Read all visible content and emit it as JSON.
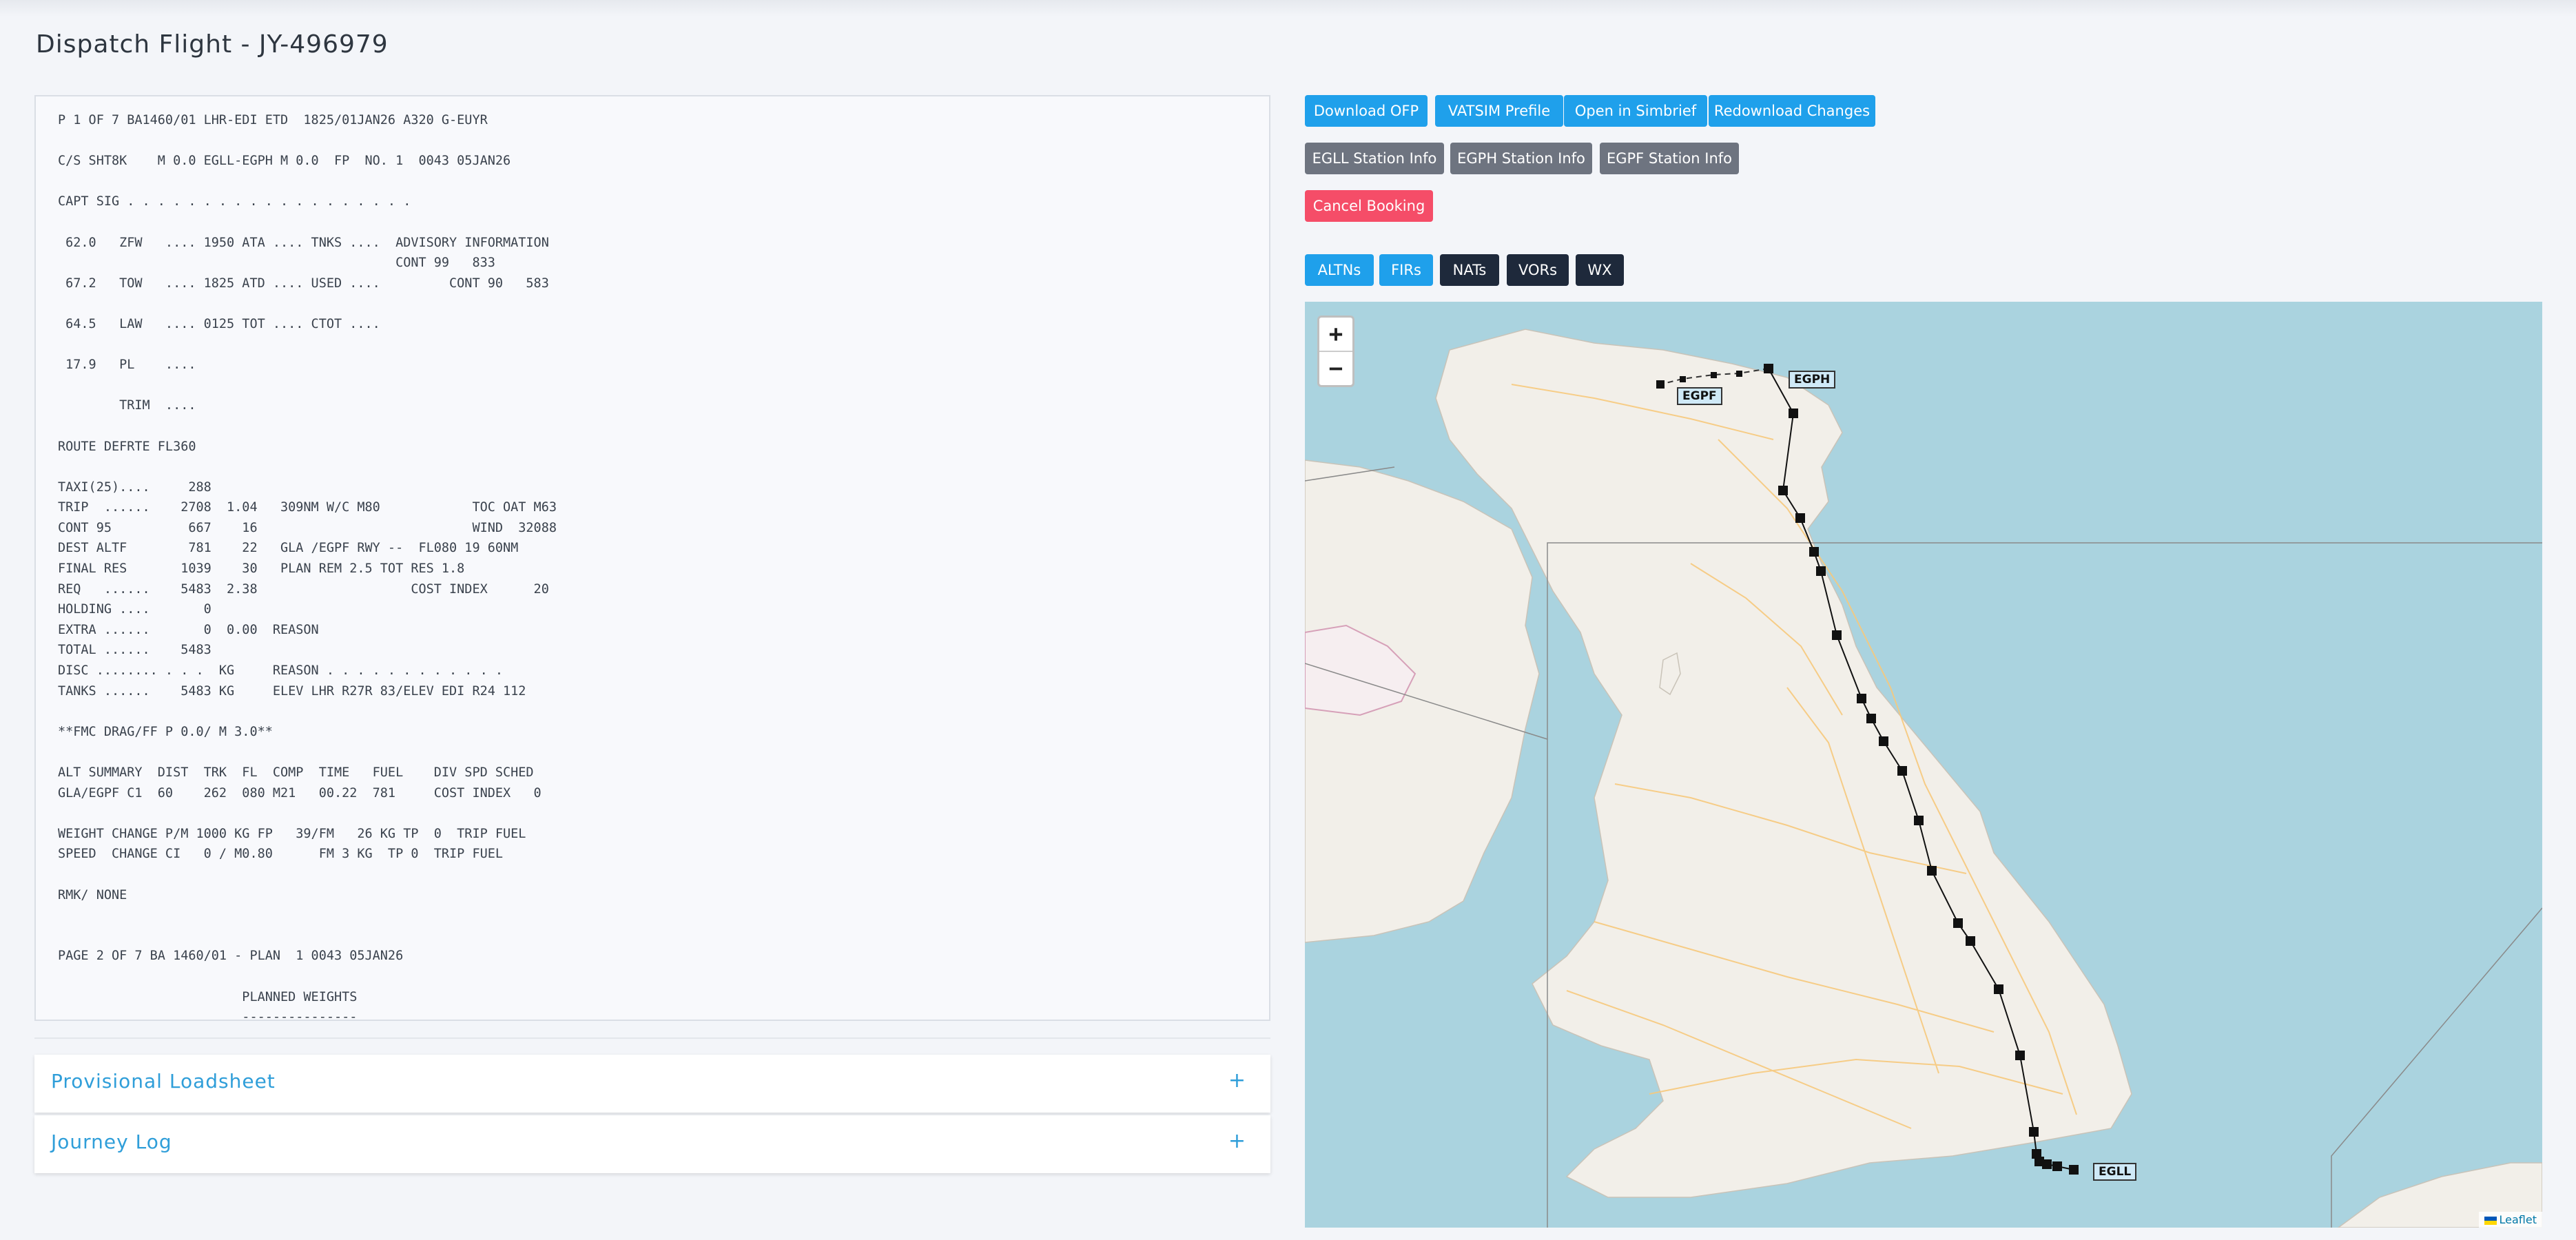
{
  "page": {
    "title": "Dispatch Flight - JY-496979"
  },
  "ofp": {
    "lines": [
      "P 1 OF 7 BA1460/01 LHR-EDI ETD  1825/01JAN26 A320 G-EUYR",
      "",
      "C/S SHT8K    M 0.0 EGLL-EGPH M 0.0  FP  NO. 1  0043 05JAN26",
      "",
      "CAPT SIG . . . . . . . . . . . . . . . . . . .",
      "",
      " 62.0   ZFW   .... 1950 ATA .... TNKS ....  ADVISORY INFORMATION",
      "                                            CONT 99   833",
      " 67.2   TOW   .... 1825 ATD .... USED ....         CONT 90   583",
      "",
      " 64.5   LAW   .... 0125 TOT .... CTOT ....",
      "",
      " 17.9   PL    ....",
      "",
      "        TRIM  ....",
      "",
      "ROUTE DEFRTE FL360",
      "",
      "TAXI(25)....     288",
      "TRIP  ......    2708  1.04   309NM W/C M80            TOC OAT M63",
      "CONT 95          667    16                            WIND  32088",
      "DEST ALTF        781    22   GLA /EGPF RWY --  FL080 19 60NM",
      "FINAL RES       1039    30   PLAN REM 2.5 TOT RES 1.8",
      "REQ   ......    5483  2.38                    COST INDEX      20",
      "HOLDING ....       0",
      "EXTRA ......       0  0.00  REASON",
      "TOTAL ......    5483",
      "DISC ........ . . .  KG     REASON . . . . . . . . . . . .",
      "TANKS ......    5483 KG     ELEV LHR R27R 83/ELEV EDI R24 112",
      "",
      "**FMC DRAG/FF P 0.0/ M 3.0**",
      "",
      "ALT SUMMARY  DIST  TRK  FL  COMP  TIME   FUEL    DIV SPD SCHED",
      "GLA/EGPF C1  60    262  080 M21   00.22  781     COST INDEX   0",
      "",
      "WEIGHT CHANGE P/M 1000 KG FP   39/FM   26 KG TP  0  TRIP FUEL",
      "SPEED  CHANGE CI   0 / M0.80      FM 3 KG  TP 0  TRIP FUEL",
      "",
      "RMK/ NONE",
      "",
      "",
      "PAGE 2 OF 7 BA 1460/01 - PLAN  1 0043 05JAN26",
      "",
      "                        PLANNED WEIGHTS",
      "                        ---------------"
    ]
  },
  "accordions": {
    "loadsheet": {
      "title": "Provisional Loadsheet",
      "toggle": "+"
    },
    "journey": {
      "title": "Journey Log",
      "toggle": "+"
    }
  },
  "actions": {
    "download_ofp": "Download OFP",
    "vatsim_prefile": "VATSIM Prefile",
    "open_simbrief": "Open in Simbrief",
    "redownload": "Redownload Changes",
    "egll_info": "EGLL Station Info",
    "egph_info": "EGPH Station Info",
    "egpf_info": "EGPF Station Info",
    "cancel": "Cancel Booking"
  },
  "layers": {
    "altns": "ALTNs",
    "firs": "FIRs",
    "nats": "NATs",
    "vors": "VORs",
    "wx": "WX"
  },
  "map": {
    "zoom_in": "+",
    "zoom_out": "−",
    "attribution": "Leaflet",
    "stations": {
      "egph": "EGPH",
      "egpf": "EGPF",
      "egll": "EGLL"
    },
    "colors": {
      "land": "#f2efe9",
      "sea": "#aad3df",
      "roads": "#f7c97c",
      "route": "#111111"
    }
  }
}
